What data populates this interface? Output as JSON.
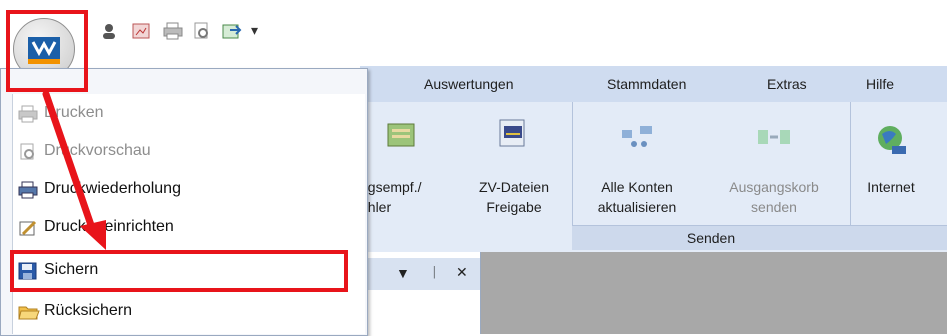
{
  "menu_tabs": [
    "Auswertungen",
    "Stammdaten",
    "Extras",
    "Hilfe"
  ],
  "app_menu": {
    "items": [
      {
        "label": "Drucken",
        "enabled": false
      },
      {
        "label": "Druckvorschau",
        "enabled": false
      },
      {
        "label": "Druckwiederholung",
        "enabled": true
      },
      {
        "label": "Drucker einrichten",
        "enabled": true
      },
      {
        "label": "Sichern",
        "enabled": true,
        "highlighted": true
      },
      {
        "label": "Rücksichern",
        "enabled": true
      }
    ]
  },
  "ribbon": {
    "btn_zahler_l1": "ngsempf./",
    "btn_zahler_l2": "ahler",
    "btn_zv_l1": "ZV-Dateien",
    "btn_zv_l2": "Freigabe",
    "btn_alle_l1": "Alle Konten",
    "btn_alle_l2": "aktualisieren",
    "btn_ausgang_l1": "Ausgangskorb",
    "btn_ausgang_l2": "senden",
    "group_senden": "Senden",
    "btn_internet": "Internet"
  },
  "panel_controls": {
    "dropdown": "▼",
    "pin": "ᛁ",
    "close": "✕"
  },
  "quick_access": {
    "overflow": "▾"
  },
  "colors": {
    "annotation_red": "#e8141a",
    "ribbon_bg": "#e3ebf7",
    "tabs_bg": "#cfdcf0"
  }
}
